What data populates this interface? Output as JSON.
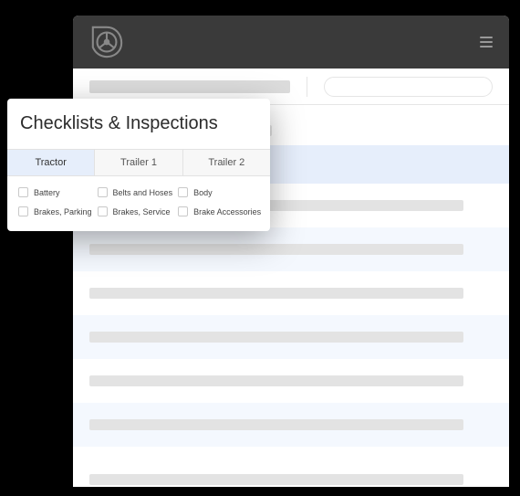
{
  "card": {
    "title": "Checklists & Inspections",
    "tabs": [
      "Tractor",
      "Trailer 1",
      "Trailer 2"
    ],
    "activeTab": 0,
    "items": [
      "Battery",
      "Belts and Hoses",
      "Body",
      "Brakes, Parking",
      "Brakes, Service",
      "Brake Accessories"
    ]
  }
}
